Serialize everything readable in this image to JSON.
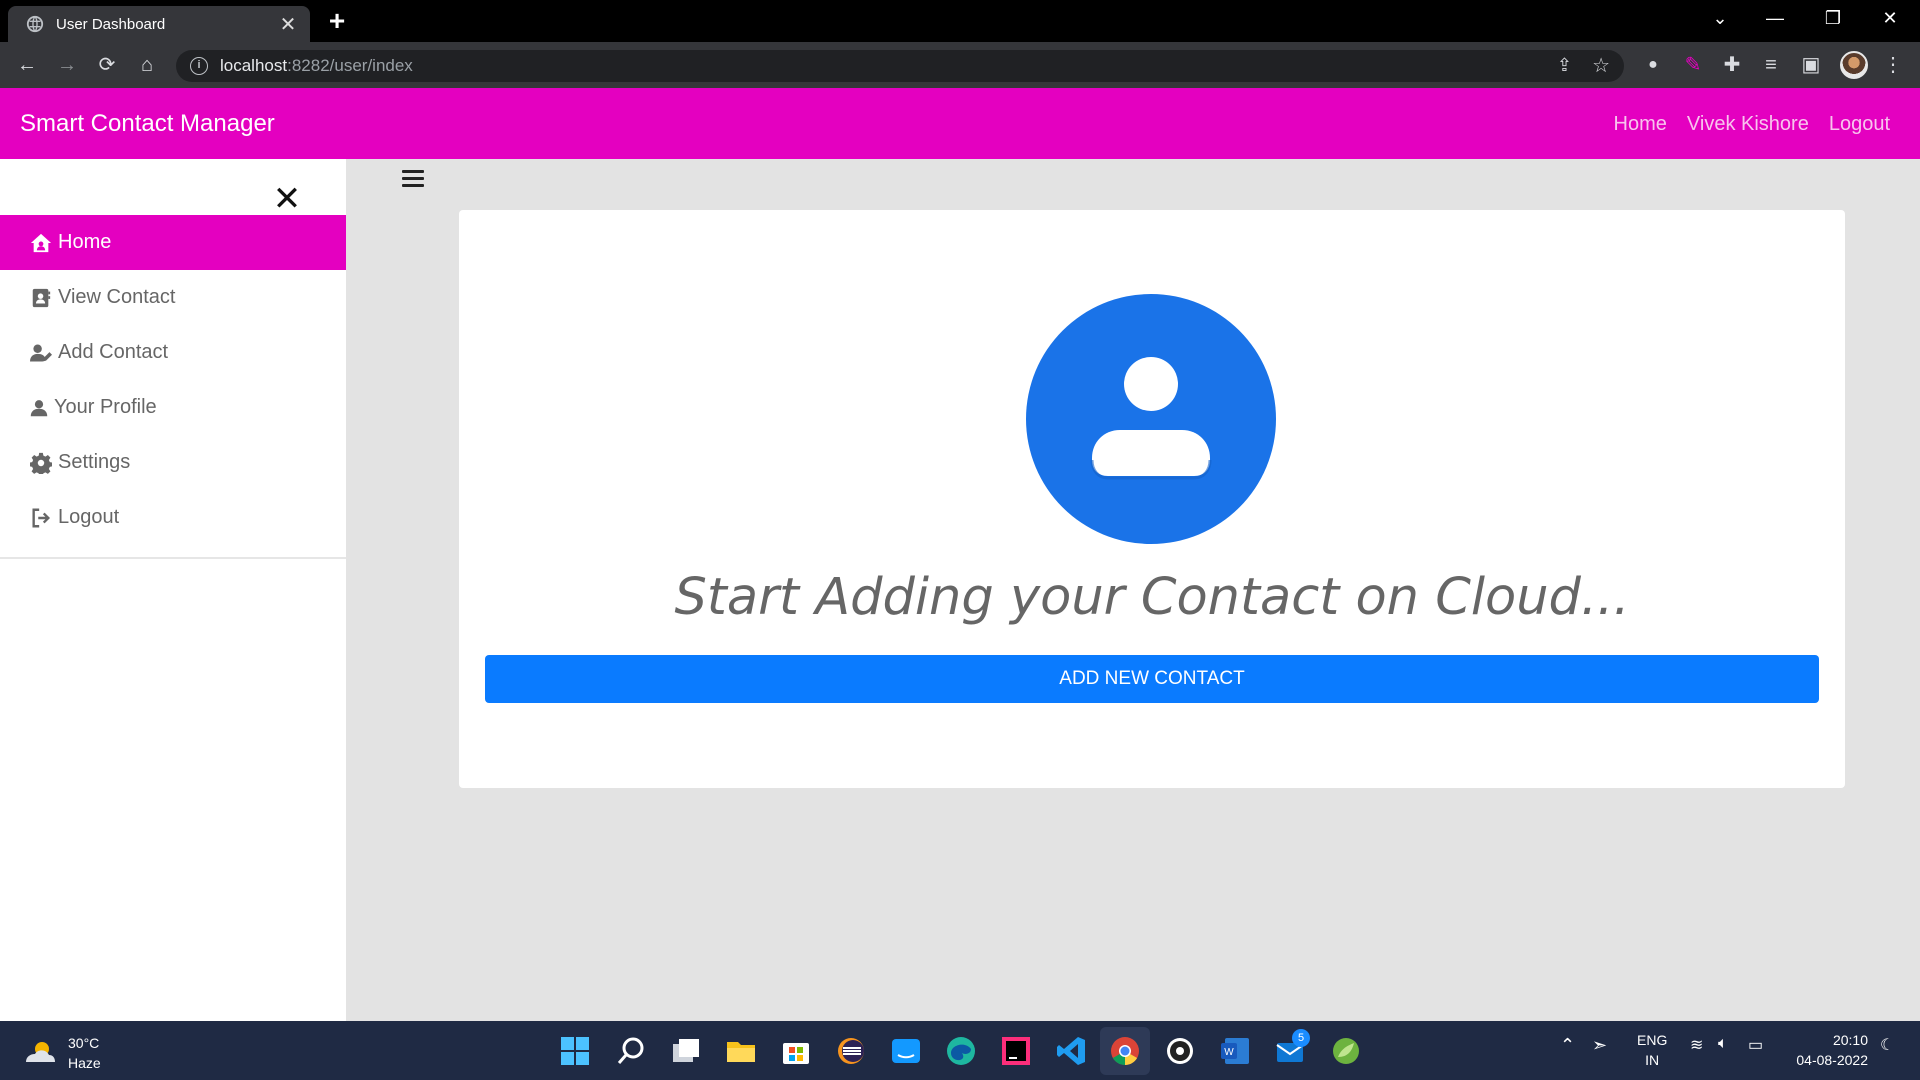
{
  "browser": {
    "tab_title": "User Dashboard",
    "url_host": "localhost",
    "url_path": ":8282/user/index"
  },
  "navbar": {
    "brand": "Smart Contact Manager",
    "links": [
      "Home",
      "Vivek Kishore",
      "Logout"
    ],
    "color": "#e400c0"
  },
  "sidebar": {
    "items": [
      {
        "label": "Home",
        "icon": "home-icon",
        "active": true
      },
      {
        "label": "View Contact",
        "icon": "address-book-icon",
        "active": false
      },
      {
        "label": "Add Contact",
        "icon": "user-pen-icon",
        "active": false
      },
      {
        "label": "Your Profile",
        "icon": "user-icon",
        "active": false
      },
      {
        "label": "Settings",
        "icon": "gear-icon",
        "active": false
      },
      {
        "label": "Logout",
        "icon": "sign-out-icon",
        "active": false
      }
    ]
  },
  "main": {
    "headline": "Start Adding your Contact on Cloud...",
    "button_label": "ADD NEW CONTACT",
    "button_color": "#0a7bff"
  },
  "taskbar": {
    "weather_temp": "30°C",
    "weather_desc": "Haze",
    "lang_top": "ENG",
    "lang_bottom": "IN",
    "time": "20:10",
    "date": "04-08-2022",
    "mail_badge": "5"
  }
}
